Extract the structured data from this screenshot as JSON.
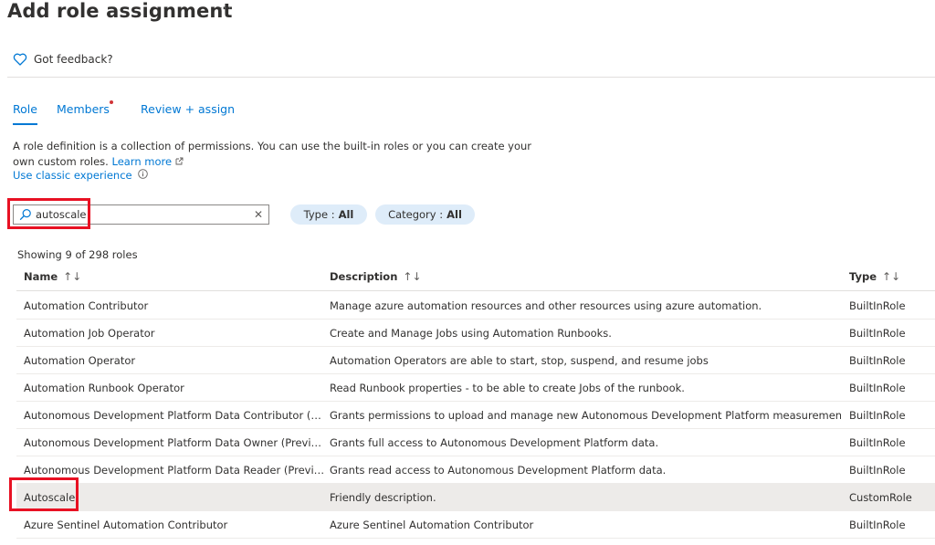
{
  "header": {
    "title": "Add role assignment",
    "more": "···"
  },
  "feedback": {
    "label": "Got feedback?"
  },
  "tabs": [
    {
      "label": "Role",
      "active": true
    },
    {
      "label": "Members",
      "active": false,
      "required_dot": true
    },
    {
      "label": "Review + assign",
      "active": false
    }
  ],
  "intro": {
    "text": "A role definition is a collection of permissions. You can use the built-in roles or you can create your own custom roles.",
    "learn_more": "Learn more",
    "classic": "Use classic experience"
  },
  "search": {
    "value": "autoscale",
    "placeholder": ""
  },
  "filters": [
    {
      "label": "Type : ",
      "value": "All"
    },
    {
      "label": "Category : ",
      "value": "All"
    }
  ],
  "results": {
    "count_text": "Showing 9 of 298 roles"
  },
  "table": {
    "columns": [
      {
        "label": "Name"
      },
      {
        "label": "Description"
      },
      {
        "label": "Type"
      }
    ],
    "rows": [
      {
        "name": "Automation Contributor",
        "description": "Manage azure automation resources and other resources using azure automation.",
        "type": "BuiltInRole"
      },
      {
        "name": "Automation Job Operator",
        "description": "Create and Manage Jobs using Automation Runbooks.",
        "type": "BuiltInRole"
      },
      {
        "name": "Automation Operator",
        "description": "Automation Operators are able to start, stop, suspend, and resume jobs",
        "type": "BuiltInRole"
      },
      {
        "name": "Automation Runbook Operator",
        "description": "Read Runbook properties - to be able to create Jobs of the runbook.",
        "type": "BuiltInRole"
      },
      {
        "name": "Autonomous Development Platform Data Contributor (Preview)",
        "description": "Grants permissions to upload and manage new Autonomous Development Platform measurements.",
        "type": "BuiltInRole"
      },
      {
        "name": "Autonomous Development Platform Data Owner (Preview)",
        "description": "Grants full access to Autonomous Development Platform data.",
        "type": "BuiltInRole"
      },
      {
        "name": "Autonomous Development Platform Data Reader (Preview)",
        "description": "Grants read access to Autonomous Development Platform data.",
        "type": "BuiltInRole"
      },
      {
        "name": "Autoscale",
        "description": "Friendly description.",
        "type": "CustomRole",
        "selected": true
      },
      {
        "name": "Azure Sentinel Automation Contributor",
        "description": "Azure Sentinel Automation Contributor",
        "type": "BuiltInRole"
      }
    ]
  },
  "colors": {
    "accent": "#0078d4",
    "highlight": "#e81123",
    "pill_bg": "#deecf9",
    "required_dot": "#d13438"
  },
  "icons": {
    "feedback": "heart-icon",
    "search": "search-icon",
    "clear": "close-icon",
    "info": "info-icon",
    "external": "external-link-icon",
    "sort": "sort-icon"
  }
}
